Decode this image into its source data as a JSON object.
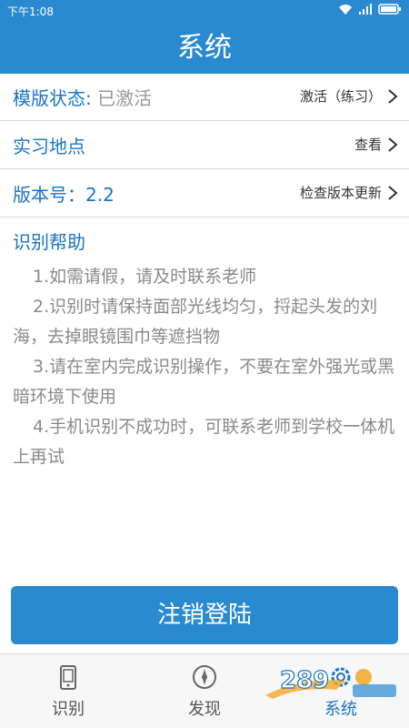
{
  "status_bar": {
    "time": "下午1:08"
  },
  "header": {
    "title": "系统"
  },
  "rows": {
    "template_status": {
      "label": "模版状态:",
      "value": "已激活",
      "action": "激活（练习）"
    },
    "internship_location": {
      "label": "实习地点",
      "action": "查看"
    },
    "version": {
      "label": "版本号：2.2",
      "action": "检查版本更新"
    }
  },
  "help": {
    "title": "识别帮助",
    "items": [
      "1.如需请假，请及时联系老师",
      "2.识别时请保持面部光线均匀，捋起头发的刘海，去掉眼镜围巾等遮挡物",
      "3.请在室内完成识别操作，不要在室外强光或黑暗环境下使用",
      "4.手机识别不成功时，可联系老师到学校一体机上再试"
    ]
  },
  "logout_button": {
    "label": "注销登陆"
  },
  "tabs": [
    {
      "label": "识别",
      "icon": "phone-icon"
    },
    {
      "label": "发现",
      "icon": "compass-icon"
    },
    {
      "label": "系统",
      "icon": "gear-icon",
      "active": true
    }
  ],
  "colors": {
    "primary": "#2a8ad0",
    "text_blue": "#1a74c4"
  }
}
